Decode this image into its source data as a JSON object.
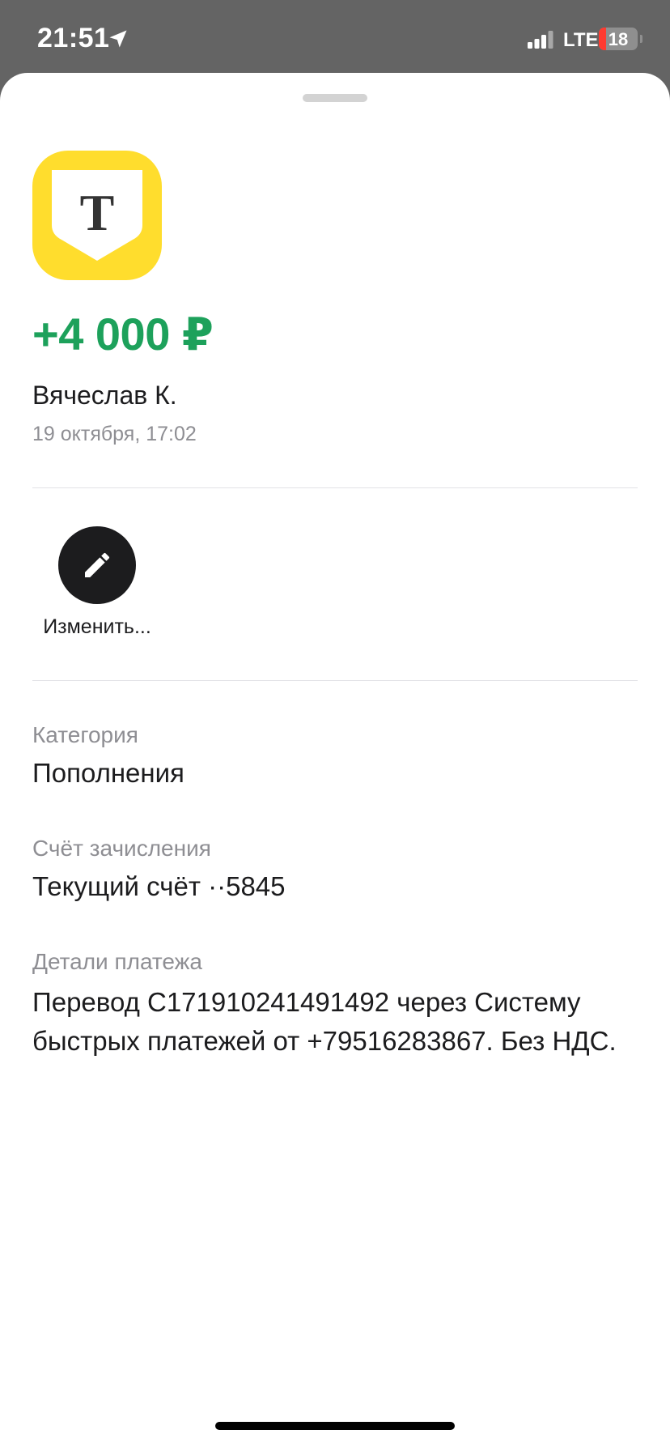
{
  "status_bar": {
    "time": "21:51",
    "network": "LTE",
    "battery": "18",
    "battery_level": 0.18,
    "icons": [
      "location-arrow-icon",
      "cellular-signal-icon",
      "battery-icon"
    ]
  },
  "header": {
    "logo_icon": "tbank-shield-logo",
    "logo_letter": "Т",
    "amount": "+4 000 ₽",
    "amount_color": "#1da15b",
    "sender": "Вячеслав К.",
    "datetime": "19 октября, 17:02"
  },
  "actions": [
    {
      "label": "Изменить...",
      "icon": "pencil-icon"
    }
  ],
  "fields": {
    "category": {
      "label": "Категория",
      "value": "Пополнения"
    },
    "account": {
      "label": "Счёт зачисления",
      "value": "Текущий счёт ··5845"
    },
    "details": {
      "label": "Детали платежа",
      "value": "Перевод C171910241491492 через Систему быстрых платежей от +79516283867. Без НДС."
    }
  }
}
